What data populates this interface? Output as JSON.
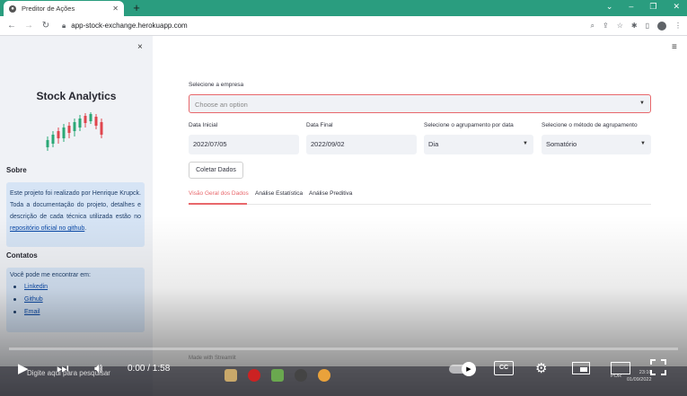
{
  "browser": {
    "tab_title": "Preditor de Ações",
    "tab_close": "✕",
    "new_tab": "+",
    "url": "app-stock-exchange.herokuapp.com"
  },
  "sidebar": {
    "close": "×",
    "brand": "Stock Analytics",
    "about_title": "Sobre",
    "about_text": "Este projeto foi realizado por Henrique Krupck. Toda a documentação do projeto, detalhes e descrição de cada técnica utilizada estão no ",
    "about_link": "repositório oficial no github",
    "about_end": ".",
    "contacts_title": "Contatos",
    "contacts_intro": "Você pode me encontrar em:",
    "contacts": [
      "Linkedin",
      "Github",
      "Email"
    ]
  },
  "main": {
    "company_label": "Selecione a empresa",
    "company_placeholder": "Choose an option",
    "start_label": "Data Inicial",
    "start_value": "2022/07/05",
    "end_label": "Data Final",
    "end_value": "2022/09/02",
    "group_label": "Selecione o agrupamento por data",
    "group_value": "Dia",
    "method_label": "Selecione o método de agrupamento",
    "method_value": "Somatório",
    "collect_button": "Coletar Dados",
    "tabs": [
      "Visão Geral dos Dados",
      "Análise Estatística",
      "Análise Preditiva"
    ],
    "made_with": "Made with Streamlit"
  },
  "video": {
    "time": "0:00 / 1:58",
    "cc_label": "CC",
    "progress": 0
  },
  "taskbar": {
    "search": "Digite aqui para pesquisar",
    "time": "23:10",
    "date": "01/09/2022",
    "lang": "POR"
  }
}
